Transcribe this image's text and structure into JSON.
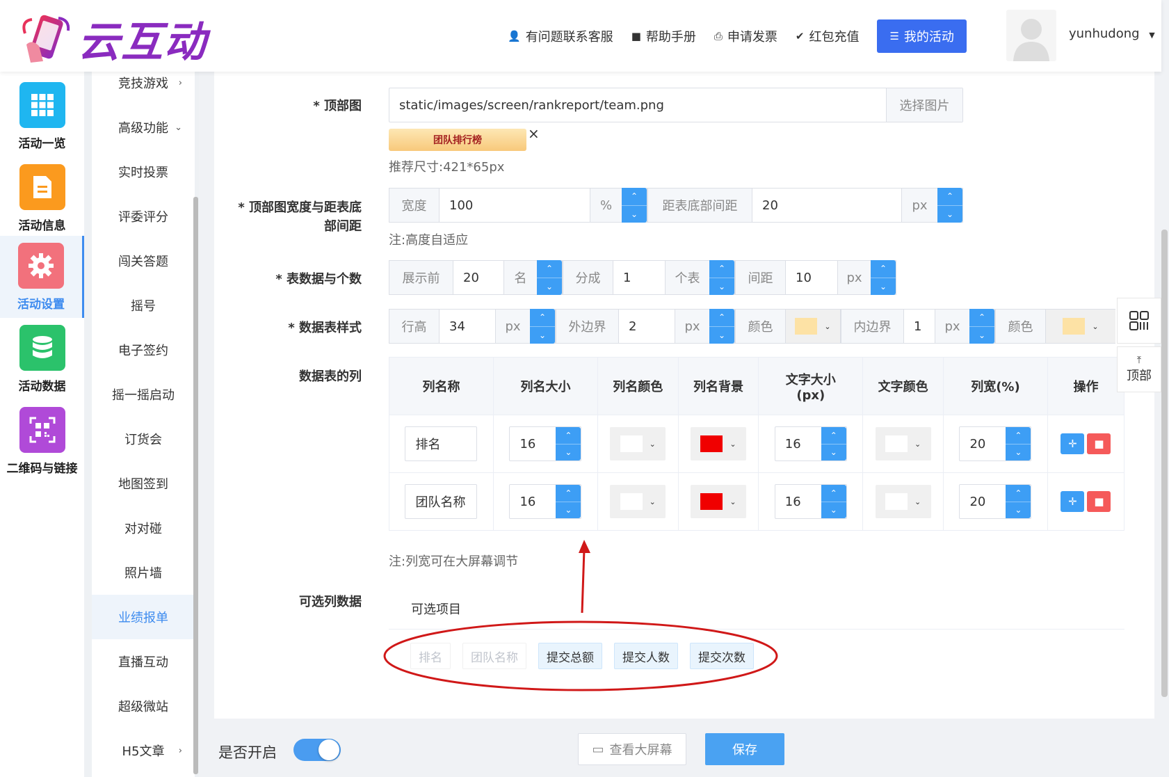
{
  "brand": {
    "name": "云互动"
  },
  "topnav": {
    "service": "有问题联系客服",
    "help": "帮助手册",
    "invoice": "申请发票",
    "recharge": "红包充值",
    "my_activity": "我的活动",
    "username": "yunhudong"
  },
  "rail": [
    {
      "label": "活动一览",
      "color": "#1fb6f0",
      "icon": "grid-icon"
    },
    {
      "label": "活动信息",
      "color": "#fb9a1e",
      "icon": "document-icon"
    },
    {
      "label": "活动设置",
      "color": "#f2717c",
      "icon": "gear-icon"
    },
    {
      "label": "活动数据",
      "color": "#2bc26b",
      "icon": "database-icon"
    },
    {
      "label": "二维码与链接",
      "color": "#b04ad8",
      "icon": "qrcode-icon"
    }
  ],
  "submenu": [
    "竞技游戏",
    "高级功能",
    "实时投票",
    "评委评分",
    "闯关答题",
    "摇号",
    "电子签约",
    "摇一摇启动",
    "订货会",
    "地图签到",
    "对对碰",
    "照片墙",
    "业绩报单",
    "直播互动",
    "超级微站",
    "H5文章"
  ],
  "form": {
    "top_image_label": "* 顶部图",
    "top_image_path": "static/images/screen/rankreport/team.png",
    "choose_image": "选择图片",
    "banner_text": "团队排行榜",
    "close_glyph": "×",
    "size_hint": "推荐尺寸:421*65px",
    "width_label_1": "* 顶部图宽度与距表底",
    "width_label_2": "部间距",
    "width_prefix": "宽度",
    "width_value": "100",
    "width_unit": "%",
    "bottom_gap_prefix": "距表底部间距",
    "bottom_gap_value": "20",
    "bottom_gap_unit": "px",
    "height_note": "注:高度自适应",
    "count_label": "* 表数据与个数",
    "show_prefix": "展示前",
    "show_value": "20",
    "show_unit": "名",
    "split_prefix": "分成",
    "split_value": "1",
    "split_unit": "个表",
    "gap_prefix": "间距",
    "gap_value": "10",
    "gap_unit": "px",
    "style_label": "* 数据表样式",
    "row_h_prefix": "行高",
    "row_h_value": "34",
    "row_h_unit": "px",
    "outer_prefix": "外边界",
    "outer_value": "2",
    "outer_unit": "px",
    "color_prefix": "颜色",
    "inner_prefix": "内边界",
    "inner_value": "1",
    "inner_unit": "px",
    "color2_prefix": "颜色",
    "style_color": "#fde2a5",
    "columns_label": "数据表的列",
    "col_note": "注:列宽可在大屏幕调节",
    "optional_label": "可选列数据",
    "optional_header": "可选项目"
  },
  "table": {
    "headers": [
      "列名称",
      "列名大小",
      "列名颜色",
      "列名背景",
      "文字大小",
      "(px)",
      "文字颜色",
      "列宽(%)",
      "操作"
    ],
    "rows": [
      {
        "name": "排名",
        "name_size": "16",
        "name_bg": "#f00000",
        "text_size": "16",
        "width": "20"
      },
      {
        "name": "团队名称",
        "name_size": "16",
        "name_bg": "#f00000",
        "text_size": "16",
        "width": "20"
      }
    ]
  },
  "optional_tags": [
    {
      "label": "排名",
      "state": "used"
    },
    {
      "label": "团队名称",
      "state": "used"
    },
    {
      "label": "提交总额",
      "state": "available"
    },
    {
      "label": "提交人数",
      "state": "available"
    },
    {
      "label": "提交次数",
      "state": "available"
    }
  ],
  "bottom": {
    "enable_label": "是否开启",
    "enabled": true,
    "view_screen": "查看大屏幕",
    "save": "保存"
  },
  "float": {
    "top_label": "顶部"
  }
}
